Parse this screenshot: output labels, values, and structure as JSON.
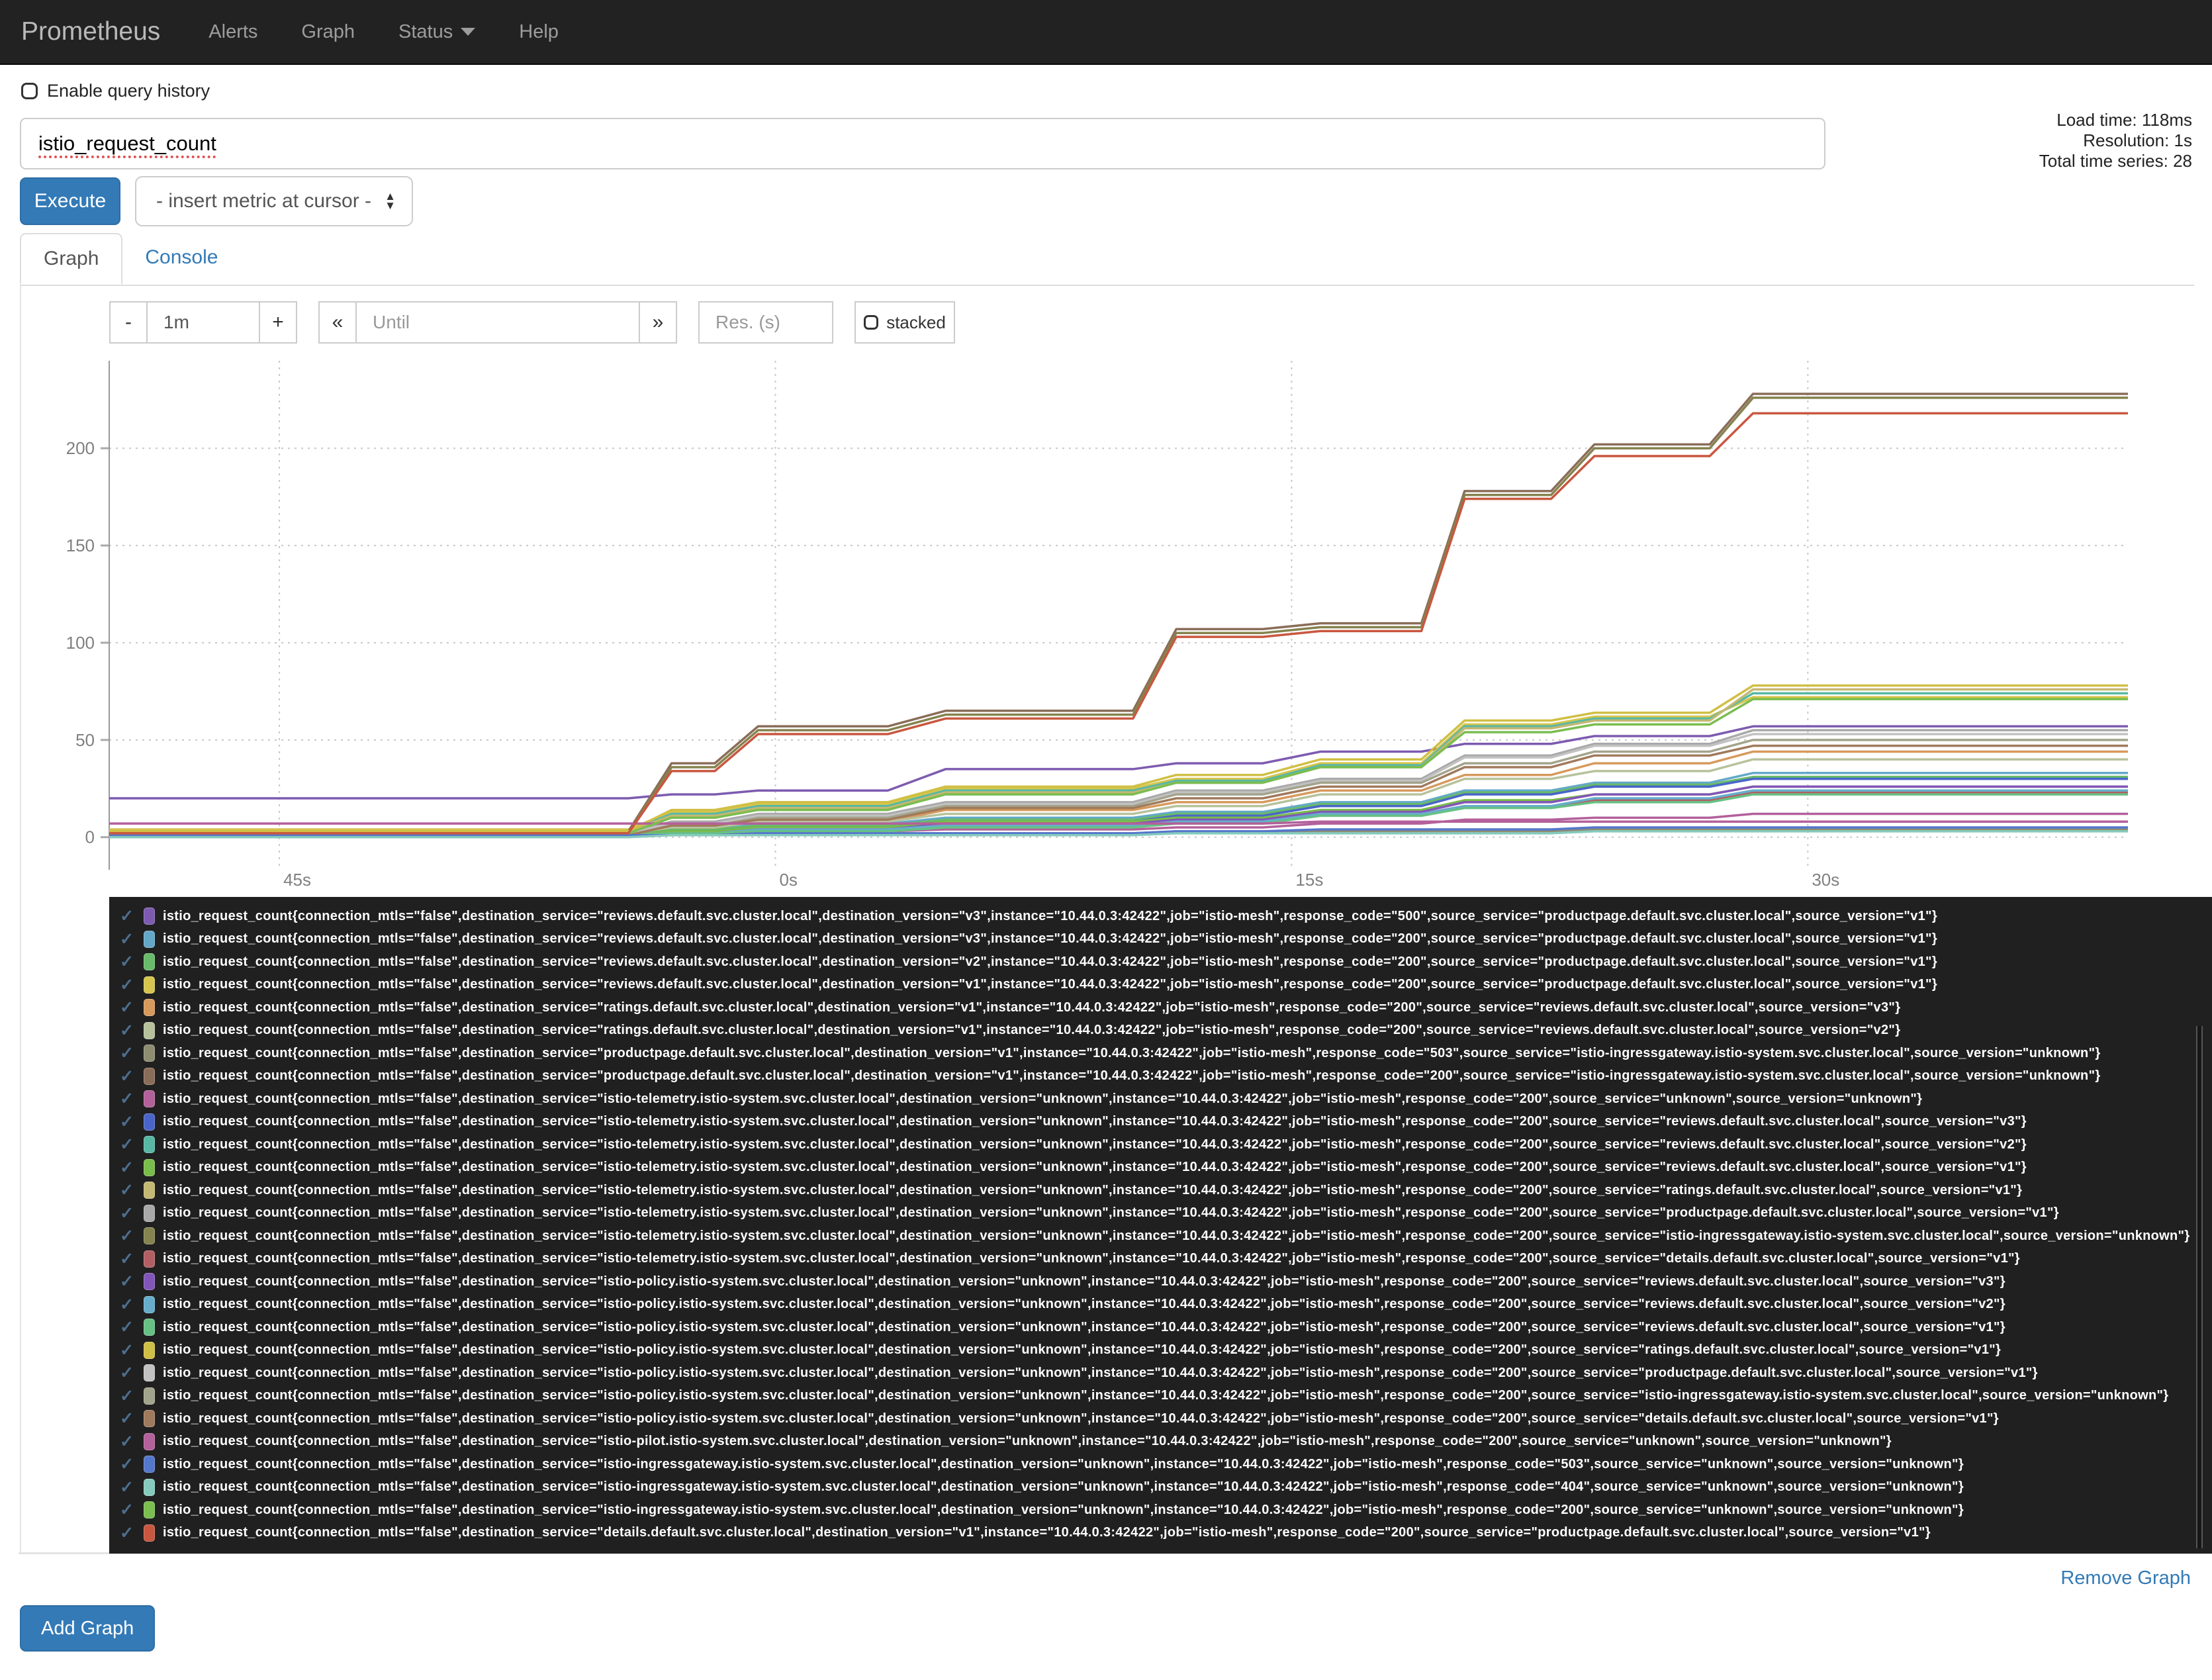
{
  "navbar": {
    "brand": "Prometheus",
    "items": [
      {
        "label": "Alerts"
      },
      {
        "label": "Graph"
      },
      {
        "label": "Status",
        "dropdown": true
      },
      {
        "label": "Help"
      }
    ]
  },
  "query": {
    "history_label": "Enable query history",
    "value": "istio_request_count",
    "execute_label": "Execute",
    "metric_select": "- insert metric at cursor -",
    "stats": {
      "load_time": "Load time: 118ms",
      "resolution": "Resolution: 1s",
      "total_series": "Total time series: 28"
    }
  },
  "tabs": [
    {
      "label": "Graph",
      "active": true
    },
    {
      "label": "Console",
      "active": false
    }
  ],
  "controls": {
    "minus": "-",
    "duration": "1m",
    "plus": "+",
    "back": "«",
    "until_placeholder": "Until",
    "forward": "»",
    "res_placeholder": "Res. (s)",
    "stacked_label": "stacked"
  },
  "footer": {
    "remove_graph": "Remove Graph",
    "add_graph": "Add Graph"
  },
  "colors": {
    "accent": "#337ab7",
    "navbar_bg": "#222222",
    "legend_bg": "#202020",
    "check": "#4d6f8f"
  },
  "chart_data": {
    "type": "line",
    "title": "",
    "xlabel": "",
    "ylabel": "",
    "xlim": [
      0,
      70
    ],
    "ylim": [
      -12,
      245
    ],
    "grid": "dotted",
    "legend_position": "below",
    "yticks": [
      0,
      50,
      100,
      150,
      200
    ],
    "xticks": [
      {
        "t": 5.9,
        "label": "45s"
      },
      {
        "t": 23.1,
        "label": "0s"
      },
      {
        "t": 41.0,
        "label": "15s"
      },
      {
        "t": 58.9,
        "label": "30s"
      }
    ],
    "step_windows": [
      [
        0,
        18
      ],
      [
        19.5,
        21
      ],
      [
        22.5,
        27
      ],
      [
        29,
        35.5
      ],
      [
        37,
        40
      ],
      [
        42,
        45.5
      ],
      [
        47,
        50
      ],
      [
        51.5,
        55.5
      ],
      [
        57,
        70
      ]
    ],
    "series": [
      {
        "color": "#7d5bb0",
        "values": [
          20,
          22,
          24,
          35,
          38,
          44,
          48,
          52,
          57
        ],
        "label": "istio_request_count{connection_mtls=\"false\",destination_service=\"reviews.default.svc.cluster.local\",destination_version=\"v3\",instance=\"10.44.0.3:42422\",job=\"istio-mesh\",response_code=\"500\",source_service=\"productpage.default.svc.cluster.local\",source_version=\"v1\"}"
      },
      {
        "color": "#64a8c8",
        "values": [
          2,
          4,
          7,
          10,
          13,
          18,
          24,
          28,
          33
        ],
        "label": "istio_request_count{connection_mtls=\"false\",destination_service=\"reviews.default.svc.cluster.local\",destination_version=\"v3\",instance=\"10.44.0.3:42422\",job=\"istio-mesh\",response_code=\"200\",source_service=\"productpage.default.svc.cluster.local\",source_version=\"v1\"}"
      },
      {
        "color": "#68bb6a",
        "values": [
          2,
          4,
          6,
          9,
          12,
          17,
          23,
          27,
          31
        ],
        "label": "istio_request_count{connection_mtls=\"false\",destination_service=\"reviews.default.svc.cluster.local\",destination_version=\"v2\",instance=\"10.44.0.3:42422\",job=\"istio-mesh\",response_code=\"200\",source_service=\"productpage.default.svc.cluster.local\",source_version=\"v1\"}"
      },
      {
        "color": "#d6c54e",
        "values": [
          4,
          13,
          17,
          25,
          30,
          38,
          58,
          62,
          72
        ],
        "label": "istio_request_count{connection_mtls=\"false\",destination_service=\"reviews.default.svc.cluster.local\",destination_version=\"v1\",instance=\"10.44.0.3:42422\",job=\"istio-mesh\",response_code=\"200\",source_service=\"productpage.default.svc.cluster.local\",source_version=\"v1\"}"
      },
      {
        "color": "#d79a5d",
        "values": [
          2,
          5,
          8,
          14,
          18,
          24,
          32,
          38,
          44
        ],
        "label": "istio_request_count{connection_mtls=\"false\",destination_service=\"ratings.default.svc.cluster.local\",destination_version=\"v1\",instance=\"10.44.0.3:42422\",job=\"istio-mesh\",response_code=\"200\",source_service=\"reviews.default.svc.cluster.local\",source_version=\"v3\"}"
      },
      {
        "color": "#b7c29c",
        "values": [
          2,
          5,
          8,
          12,
          16,
          22,
          30,
          34,
          40
        ],
        "label": "istio_request_count{connection_mtls=\"false\",destination_service=\"ratings.default.svc.cluster.local\",destination_version=\"v1\",instance=\"10.44.0.3:42422\",job=\"istio-mesh\",response_code=\"200\",source_service=\"reviews.default.svc.cluster.local\",source_version=\"v2\"}"
      },
      {
        "color": "#8e8d71",
        "values": [
          1,
          1,
          2,
          2,
          3,
          3,
          3,
          4,
          4
        ],
        "label": "istio_request_count{connection_mtls=\"false\",destination_service=\"productpage.default.svc.cluster.local\",destination_version=\"v1\",instance=\"10.44.0.3:42422\",job=\"istio-mesh\",response_code=\"503\",source_service=\"istio-ingressgateway.istio-system.svc.cluster.local\",source_version=\"unknown\"}"
      },
      {
        "color": "#8a6d58",
        "values": [
          3,
          38,
          57,
          65,
          107,
          110,
          178,
          202,
          228
        ],
        "label": "istio_request_count{connection_mtls=\"false\",destination_service=\"productpage.default.svc.cluster.local\",destination_version=\"v1\",instance=\"10.44.0.3:42422\",job=\"istio-mesh\",response_code=\"200\",source_service=\"istio-ingressgateway.istio-system.svc.cluster.local\",source_version=\"unknown\"}"
      },
      {
        "color": "#b3609b",
        "values": [
          1,
          2,
          3,
          4,
          5,
          7,
          9,
          10,
          12
        ],
        "label": "istio_request_count{connection_mtls=\"false\",destination_service=\"istio-telemetry.istio-system.svc.cluster.local\",destination_version=\"unknown\",instance=\"10.44.0.3:42422\",job=\"istio-mesh\",response_code=\"200\",source_service=\"unknown\",source_version=\"unknown\"}"
      },
      {
        "color": "#4a65c9",
        "values": [
          1,
          3,
          5,
          8,
          11,
          16,
          22,
          26,
          30
        ],
        "label": "istio_request_count{connection_mtls=\"false\",destination_service=\"istio-telemetry.istio-system.svc.cluster.local\",destination_version=\"unknown\",instance=\"10.44.0.3:42422\",job=\"istio-mesh\",response_code=\"200\",source_service=\"reviews.default.svc.cluster.local\",source_version=\"v3\"}"
      },
      {
        "color": "#57b8a4",
        "values": [
          3,
          12,
          16,
          24,
          29,
          37,
          57,
          61,
          74
        ],
        "label": "istio_request_count{connection_mtls=\"false\",destination_service=\"istio-telemetry.istio-system.svc.cluster.local\",destination_version=\"unknown\",instance=\"10.44.0.3:42422\",job=\"istio-mesh\",response_code=\"200\",source_service=\"reviews.default.svc.cluster.local\",source_version=\"v2\"}"
      },
      {
        "color": "#79bd4a",
        "values": [
          1,
          3,
          5,
          8,
          10,
          14,
          19,
          22,
          26
        ],
        "label": "istio_request_count{connection_mtls=\"false\",destination_service=\"istio-telemetry.istio-system.svc.cluster.local\",destination_version=\"unknown\",instance=\"10.44.0.3:42422\",job=\"istio-mesh\",response_code=\"200\",source_service=\"reviews.default.svc.cluster.local\",source_version=\"v1\"}"
      },
      {
        "color": "#c4b873",
        "values": [
          3,
          11,
          15,
          23,
          28,
          36,
          56,
          60,
          76
        ],
        "label": "istio_request_count{connection_mtls=\"false\",destination_service=\"istio-telemetry.istio-system.svc.cluster.local\",destination_version=\"unknown\",instance=\"10.44.0.3:42422\",job=\"istio-mesh\",response_code=\"200\",source_service=\"ratings.default.svc.cluster.local\",source_version=\"v1\"}"
      },
      {
        "color": "#a9a9a9",
        "values": [
          2,
          8,
          12,
          18,
          24,
          30,
          42,
          48,
          55
        ],
        "label": "istio_request_count{connection_mtls=\"false\",destination_service=\"istio-telemetry.istio-system.svc.cluster.local\",destination_version=\"unknown\",instance=\"10.44.0.3:42422\",job=\"istio-mesh\",response_code=\"200\",source_service=\"productpage.default.svc.cluster.local\",source_version=\"v1\"}"
      },
      {
        "color": "#85834f",
        "values": [
          2,
          36,
          55,
          63,
          105,
          108,
          176,
          200,
          226
        ],
        "label": "istio_request_count{connection_mtls=\"false\",destination_service=\"istio-telemetry.istio-system.svc.cluster.local\",destination_version=\"unknown\",instance=\"10.44.0.3:42422\",job=\"istio-mesh\",response_code=\"200\",source_service=\"istio-ingressgateway.istio-system.svc.cluster.local\",source_version=\"unknown\"}"
      },
      {
        "color": "#b25f63",
        "values": [
          1,
          2,
          4,
          6,
          8,
          12,
          16,
          19,
          23
        ],
        "label": "istio_request_count{connection_mtls=\"false\",destination_service=\"istio-telemetry.istio-system.svc.cluster.local\",destination_version=\"unknown\",instance=\"10.44.0.3:42422\",job=\"istio-mesh\",response_code=\"200\",source_service=\"details.default.svc.cluster.local\",source_version=\"v1\"}"
      },
      {
        "color": "#8256b8",
        "values": [
          1,
          2,
          4,
          7,
          9,
          13,
          18,
          22,
          26
        ],
        "label": "istio_request_count{connection_mtls=\"false\",destination_service=\"istio-policy.istio-system.svc.cluster.local\",destination_version=\"unknown\",instance=\"10.44.0.3:42422\",job=\"istio-mesh\",response_code=\"200\",source_service=\"reviews.default.svc.cluster.local\",source_version=\"v3\"}"
      },
      {
        "color": "#66aecb",
        "values": [
          1,
          2,
          4,
          6,
          8,
          12,
          16,
          20,
          24
        ],
        "label": "istio_request_count{connection_mtls=\"false\",destination_service=\"istio-policy.istio-system.svc.cluster.local\",destination_version=\"unknown\",instance=\"10.44.0.3:42422\",job=\"istio-mesh\",response_code=\"200\",source_service=\"reviews.default.svc.cluster.local\",source_version=\"v2\"}"
      },
      {
        "color": "#67c184",
        "values": [
          1,
          2,
          3,
          5,
          7,
          11,
          15,
          18,
          22
        ],
        "label": "istio_request_count{connection_mtls=\"false\",destination_service=\"istio-policy.istio-system.svc.cluster.local\",destination_version=\"unknown\",instance=\"10.44.0.3:42422\",job=\"istio-mesh\",response_code=\"200\",source_service=\"reviews.default.svc.cluster.local\",source_version=\"v1\"}"
      },
      {
        "color": "#d0bf45",
        "values": [
          3,
          14,
          18,
          26,
          32,
          40,
          60,
          64,
          78
        ],
        "label": "istio_request_count{connection_mtls=\"false\",destination_service=\"istio-policy.istio-system.svc.cluster.local\",destination_version=\"unknown\",instance=\"10.44.0.3:42422\",job=\"istio-mesh\",response_code=\"200\",source_service=\"ratings.default.svc.cluster.local\",source_version=\"v1\"}"
      },
      {
        "color": "#c2c2c2",
        "values": [
          2,
          7,
          11,
          17,
          23,
          29,
          41,
          47,
          53
        ],
        "label": "istio_request_count{connection_mtls=\"false\",destination_service=\"istio-policy.istio-system.svc.cluster.local\",destination_version=\"unknown\",instance=\"10.44.0.3:42422\",job=\"istio-mesh\",response_code=\"200\",source_service=\"productpage.default.svc.cluster.local\",source_version=\"v1\"}"
      },
      {
        "color": "#a3a48c",
        "values": [
          1,
          6,
          10,
          16,
          22,
          28,
          38,
          44,
          50
        ],
        "label": "istio_request_count{connection_mtls=\"false\",destination_service=\"istio-policy.istio-system.svc.cluster.local\",destination_version=\"unknown\",instance=\"10.44.0.3:42422\",job=\"istio-mesh\",response_code=\"200\",source_service=\"istio-ingressgateway.istio-system.svc.cluster.local\",source_version=\"unknown\"}"
      },
      {
        "color": "#a07a5c",
        "values": [
          1,
          6,
          9,
          15,
          20,
          26,
          36,
          42,
          47
        ],
        "label": "istio_request_count{connection_mtls=\"false\",destination_service=\"istio-policy.istio-system.svc.cluster.local\",destination_version=\"unknown\",instance=\"10.44.0.3:42422\",job=\"istio-mesh\",response_code=\"200\",source_service=\"details.default.svc.cluster.local\",source_version=\"v1\"}"
      },
      {
        "color": "#b3609b",
        "values": [
          7,
          7,
          7,
          7,
          7,
          8,
          8,
          8,
          8
        ],
        "label": "istio_request_count{connection_mtls=\"false\",destination_service=\"istio-pilot.istio-system.svc.cluster.local\",destination_version=\"unknown\",instance=\"10.44.0.3:42422\",job=\"istio-mesh\",response_code=\"200\",source_service=\"unknown\",source_version=\"unknown\"}"
      },
      {
        "color": "#5577cc",
        "values": [
          1,
          1,
          2,
          2,
          3,
          4,
          4,
          5,
          5
        ],
        "label": "istio_request_count{connection_mtls=\"false\",destination_service=\"istio-ingressgateway.istio-system.svc.cluster.local\",destination_version=\"unknown\",instance=\"10.44.0.3:42422\",job=\"istio-mesh\",response_code=\"503\",source_service=\"unknown\",source_version=\"unknown\"}"
      },
      {
        "color": "#85cbbd",
        "values": [
          0,
          1,
          1,
          1,
          2,
          2,
          2,
          3,
          3
        ],
        "label": "istio_request_count{connection_mtls=\"false\",destination_service=\"istio-ingressgateway.istio-system.svc.cluster.local\",destination_version=\"unknown\",instance=\"10.44.0.3:42422\",job=\"istio-mesh\",response_code=\"404\",source_service=\"unknown\",source_version=\"unknown\"}"
      },
      {
        "color": "#7bbd4f",
        "values": [
          2,
          10,
          14,
          22,
          28,
          36,
          54,
          58,
          71
        ],
        "label": "istio_request_count{connection_mtls=\"false\",destination_service=\"istio-ingressgateway.istio-system.svc.cluster.local\",destination_version=\"unknown\",instance=\"10.44.0.3:42422\",job=\"istio-mesh\",response_code=\"200\",source_service=\"unknown\",source_version=\"unknown\"}"
      },
      {
        "color": "#c9573f",
        "values": [
          2,
          34,
          53,
          61,
          103,
          106,
          174,
          196,
          218
        ],
        "label": "istio_request_count{connection_mtls=\"false\",destination_service=\"details.default.svc.cluster.local\",destination_version=\"v1\",instance=\"10.44.0.3:42422\",job=\"istio-mesh\",response_code=\"200\",source_service=\"productpage.default.svc.cluster.local\",source_version=\"v1\"}"
      }
    ]
  }
}
